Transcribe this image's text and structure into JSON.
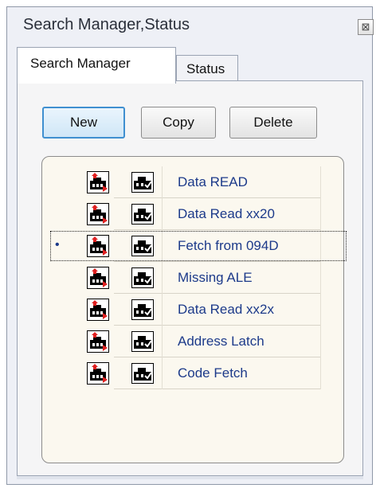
{
  "window": {
    "title": "Search Manager,Status",
    "close_glyph": "⊠"
  },
  "tabs": [
    {
      "label": "Search Manager",
      "active": true
    },
    {
      "label": "Status",
      "active": false
    }
  ],
  "toolbar": {
    "new_label": "New",
    "copy_label": "Copy",
    "delete_label": "Delete"
  },
  "search_list": {
    "selected_bullet": "•",
    "items": [
      {
        "label": "Data READ",
        "selected": false
      },
      {
        "label": "Data Read xx20",
        "selected": false
      },
      {
        "label": "Fetch from 094D",
        "selected": true
      },
      {
        "label": "Missing ALE",
        "selected": false
      },
      {
        "label": "Data Read xx2x",
        "selected": false
      },
      {
        "label": "Address Latch",
        "selected": false
      },
      {
        "label": "Code Fetch",
        "selected": false
      }
    ]
  },
  "icons": {
    "edit": "edit-search-icon",
    "enable": "enable-search-icon"
  },
  "colors": {
    "item_text": "#1c3a8a",
    "list_background": "#fbf8ef",
    "new_button_border": "#3f8fd0"
  }
}
